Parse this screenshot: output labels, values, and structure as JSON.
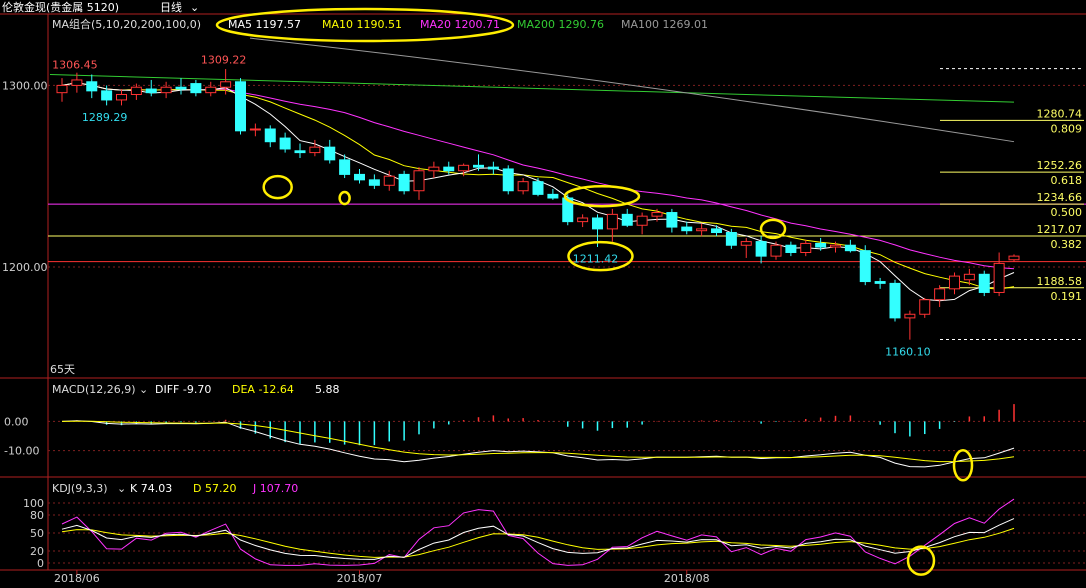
{
  "title_bar": {
    "instrument": "伦敦金现(贵金属 5120)",
    "period": "日线"
  },
  "ma_header": {
    "label": "MA组合(5,10,20,200,100,0)",
    "items": [
      {
        "text": "MA5 1197.57",
        "color": "#ffffff"
      },
      {
        "text": "MA10 1190.51",
        "color": "#ffff00"
      },
      {
        "text": "MA20 1200.71",
        "color": "#ff33ff"
      },
      {
        "text": "MA200 1290.76",
        "color": "#33cc33"
      },
      {
        "text": "MA100 1269.01",
        "color": "#999999"
      }
    ]
  },
  "macd_header": {
    "label": "MACD(12,26,9)",
    "diff": "DIFF -9.70",
    "dea": "DEA -12.64",
    "macd": "5.88"
  },
  "kdj_header": {
    "label": "KDJ(9,3,3)",
    "k": "K 74.03",
    "d": "D 57.20",
    "j": "J 107.70"
  },
  "x_labels": [
    {
      "text": "2018/06",
      "bar": 1
    },
    {
      "text": "2018/07",
      "bar": 20
    },
    {
      "text": "2018/08",
      "bar": 42
    }
  ],
  "count_label": "65天",
  "chart_data": {
    "type": "candlestick",
    "price_ticks": [
      1300,
      1200
    ],
    "price_tick_labels": [
      "1300.00",
      "1200.00"
    ],
    "price_range": [
      1140,
      1325
    ],
    "annotations": [
      {
        "text": "1306.45",
        "bar": 1,
        "price": 1306.45,
        "color": "#ff5555",
        "pos": "above"
      },
      {
        "text": "1309.22",
        "bar": 11,
        "price": 1309.22,
        "color": "#ff5555",
        "pos": "above"
      },
      {
        "text": "1289.29",
        "bar": 3,
        "price": 1289.29,
        "color": "#33ddee",
        "pos": "below"
      },
      {
        "text": "1211.42",
        "bar": 36,
        "price": 1211.42,
        "color": "#33ddee",
        "pos": "below"
      },
      {
        "text": "1160.10",
        "bar": 57,
        "price": 1160.1,
        "color": "#33ddee",
        "pos": "below"
      }
    ],
    "fib_levels": [
      {
        "price": 1280.74,
        "ratio": "0.809"
      },
      {
        "price": 1252.26,
        "ratio": "0.618"
      },
      {
        "price": 1234.66,
        "ratio": "0.500"
      },
      {
        "price": 1217.07,
        "ratio": "0.382"
      },
      {
        "price": 1188.58,
        "ratio": "0.191"
      }
    ],
    "fib_range": [
      1160.1,
      1309.22
    ],
    "h_lines": [
      {
        "price": 1234.66,
        "color": "#ff33ff"
      },
      {
        "price": 1217.07,
        "color": "#ffff66"
      },
      {
        "price": 1203.0,
        "color": "#ff3333"
      }
    ],
    "candles": [
      {
        "o": 1296,
        "h": 1304,
        "l": 1291,
        "c": 1300
      },
      {
        "o": 1300,
        "h": 1307,
        "l": 1296,
        "c": 1303
      },
      {
        "o": 1302,
        "h": 1306,
        "l": 1293,
        "c": 1297
      },
      {
        "o": 1297,
        "h": 1300,
        "l": 1289,
        "c": 1292
      },
      {
        "o": 1292,
        "h": 1298,
        "l": 1289,
        "c": 1295
      },
      {
        "o": 1295,
        "h": 1301,
        "l": 1292,
        "c": 1299
      },
      {
        "o": 1298,
        "h": 1303,
        "l": 1294,
        "c": 1296
      },
      {
        "o": 1296,
        "h": 1302,
        "l": 1293,
        "c": 1299
      },
      {
        "o": 1299,
        "h": 1304,
        "l": 1295,
        "c": 1298
      },
      {
        "o": 1301,
        "h": 1303,
        "l": 1294,
        "c": 1296
      },
      {
        "o": 1296,
        "h": 1302,
        "l": 1294,
        "c": 1299
      },
      {
        "o": 1299,
        "h": 1309,
        "l": 1295,
        "c": 1302
      },
      {
        "o": 1302,
        "h": 1304,
        "l": 1273,
        "c": 1275
      },
      {
        "o": 1276,
        "h": 1279,
        "l": 1272,
        "c": 1276
      },
      {
        "o": 1276,
        "h": 1278,
        "l": 1266,
        "c": 1269
      },
      {
        "o": 1271,
        "h": 1274,
        "l": 1263,
        "c": 1265
      },
      {
        "o": 1264,
        "h": 1268,
        "l": 1260,
        "c": 1263
      },
      {
        "o": 1263,
        "h": 1270,
        "l": 1261,
        "c": 1266
      },
      {
        "o": 1266,
        "h": 1270,
        "l": 1257,
        "c": 1259
      },
      {
        "o": 1259,
        "h": 1262,
        "l": 1249,
        "c": 1251
      },
      {
        "o": 1251,
        "h": 1254,
        "l": 1246,
        "c": 1248
      },
      {
        "o": 1248,
        "h": 1251,
        "l": 1243,
        "c": 1245
      },
      {
        "o": 1245,
        "h": 1253,
        "l": 1242,
        "c": 1250
      },
      {
        "o": 1251,
        "h": 1253,
        "l": 1240,
        "c": 1242
      },
      {
        "o": 1242,
        "h": 1255,
        "l": 1237,
        "c": 1253
      },
      {
        "o": 1253,
        "h": 1258,
        "l": 1249,
        "c": 1255
      },
      {
        "o": 1255,
        "h": 1258,
        "l": 1251,
        "c": 1253
      },
      {
        "o": 1253,
        "h": 1257,
        "l": 1250,
        "c": 1256
      },
      {
        "o": 1256,
        "h": 1262,
        "l": 1253,
        "c": 1255
      },
      {
        "o": 1255,
        "h": 1258,
        "l": 1251,
        "c": 1254
      },
      {
        "o": 1254,
        "h": 1256,
        "l": 1240,
        "c": 1242
      },
      {
        "o": 1242,
        "h": 1249,
        "l": 1240,
        "c": 1247
      },
      {
        "o": 1247,
        "h": 1249,
        "l": 1239,
        "c": 1240
      },
      {
        "o": 1240,
        "h": 1243,
        "l": 1237,
        "c": 1238
      },
      {
        "o": 1238,
        "h": 1240,
        "l": 1223,
        "c": 1225
      },
      {
        "o": 1225,
        "h": 1229,
        "l": 1222,
        "c": 1227
      },
      {
        "o": 1227,
        "h": 1229,
        "l": 1211,
        "c": 1221
      },
      {
        "o": 1221,
        "h": 1232,
        "l": 1214,
        "c": 1229
      },
      {
        "o": 1229,
        "h": 1232,
        "l": 1222,
        "c": 1223
      },
      {
        "o": 1223,
        "h": 1230,
        "l": 1218,
        "c": 1228
      },
      {
        "o": 1228,
        "h": 1232,
        "l": 1225,
        "c": 1230
      },
      {
        "o": 1230,
        "h": 1232,
        "l": 1219,
        "c": 1222
      },
      {
        "o": 1222,
        "h": 1225,
        "l": 1218,
        "c": 1220
      },
      {
        "o": 1220,
        "h": 1224,
        "l": 1217,
        "c": 1221
      },
      {
        "o": 1221,
        "h": 1223,
        "l": 1217,
        "c": 1219
      },
      {
        "o": 1219,
        "h": 1221,
        "l": 1210,
        "c": 1212
      },
      {
        "o": 1212,
        "h": 1216,
        "l": 1205,
        "c": 1214
      },
      {
        "o": 1214,
        "h": 1217,
        "l": 1202,
        "c": 1206
      },
      {
        "o": 1206,
        "h": 1214,
        "l": 1204,
        "c": 1212
      },
      {
        "o": 1212,
        "h": 1214,
        "l": 1206,
        "c": 1208
      },
      {
        "o": 1208,
        "h": 1215,
        "l": 1206,
        "c": 1213
      },
      {
        "o": 1213,
        "h": 1216,
        "l": 1209,
        "c": 1211
      },
      {
        "o": 1211,
        "h": 1214,
        "l": 1208,
        "c": 1212
      },
      {
        "o": 1212,
        "h": 1215,
        "l": 1208,
        "c": 1209
      },
      {
        "o": 1209,
        "h": 1212,
        "l": 1190,
        "c": 1192
      },
      {
        "o": 1192,
        "h": 1194,
        "l": 1188,
        "c": 1191
      },
      {
        "o": 1191,
        "h": 1193,
        "l": 1170,
        "c": 1172
      },
      {
        "o": 1172,
        "h": 1176,
        "l": 1160,
        "c": 1174
      },
      {
        "o": 1174,
        "h": 1183,
        "l": 1172,
        "c": 1182
      },
      {
        "o": 1182,
        "h": 1190,
        "l": 1178,
        "c": 1188
      },
      {
        "o": 1188,
        "h": 1197,
        "l": 1185,
        "c": 1195
      },
      {
        "o": 1193,
        "h": 1199,
        "l": 1190,
        "c": 1196
      },
      {
        "o": 1196,
        "h": 1198,
        "l": 1184,
        "c": 1186
      },
      {
        "o": 1186,
        "h": 1208,
        "l": 1184,
        "c": 1202
      },
      {
        "o": 1204,
        "h": 1207,
        "l": 1203,
        "c": 1206
      }
    ],
    "ma200": [
      1306,
      1290.76
    ],
    "ma100": [
      1324,
      1269.01
    ],
    "macd_range": [
      -18,
      8
    ],
    "macd_ticks": [
      0,
      -10
    ],
    "macd_tick_labels": [
      "0.00",
      "-10.00"
    ],
    "kdj_range": [
      -5,
      110
    ],
    "kdj_ticks": [
      100,
      80,
      50,
      20,
      0
    ],
    "kdj_tick_labels": [
      "100",
      "80",
      "50",
      "20",
      "0"
    ]
  },
  "highlights": [
    {
      "bar": 14.5,
      "price": 1244,
      "rx": 14,
      "ry": 11
    },
    {
      "bar": 19,
      "price": 1238,
      "rx": 5,
      "ry": 6
    },
    {
      "bar": 36.3,
      "price": 1239,
      "rx": 37,
      "ry": 10
    },
    {
      "bar": 47.8,
      "price": 1221,
      "rx": 12,
      "ry": 9
    },
    {
      "bar": 36.2,
      "price": 1206,
      "rx": 32,
      "ry": 14
    }
  ],
  "colors": {
    "up": "#ff3333",
    "down": "#33ffff",
    "ma5": "#ffffff",
    "ma10": "#ffff00",
    "ma20": "#ff33ff",
    "ma200": "#33cc33",
    "ma100": "#999999",
    "highlight": "#ffee00"
  }
}
